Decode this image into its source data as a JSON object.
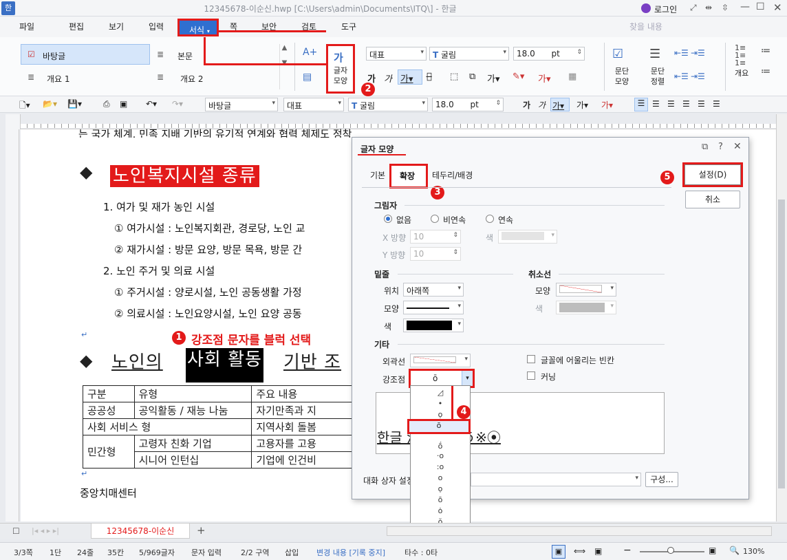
{
  "window": {
    "title": "12345678-이순신.hwp [C:\\Users\\admin\\Documents\\ITQ\\] - 한글",
    "app_icon": "한",
    "login": "로그인"
  },
  "menu": [
    "파일",
    "편집",
    "보기",
    "입력",
    "서식",
    "쪽",
    "보안",
    "검토",
    "도구"
  ],
  "ribbon": {
    "styles": [
      "바탕글",
      "본문",
      "개요 1",
      "개요 2"
    ],
    "char_shape": "글자\n모양",
    "font_lang": "대표",
    "font_name": "굴림",
    "font_size": "18.0",
    "unit": "pt",
    "para_shape": "문단\n모양",
    "para_align": "문단\n정렬",
    "outline": "개요",
    "search_placeholder": "찾을 내용"
  },
  "toolbar2": {
    "style": "바탕글",
    "lang": "대표",
    "font": "굴림",
    "size": "18.0",
    "unit": "pt"
  },
  "document": {
    "top_line": "는 국가 체계, 민족 지배 기반의 유기적 연계와 협력 체제도 정착되어야 한다.",
    "heading1": "노인복지시설 종류",
    "items": [
      "1. 여가 및 재가 농인 시설",
      "① 여가시설 : 노인복지회관, 경로당, 노인 교",
      "② 재가시설 : 방문 요양, 방문 목욕, 방문 간",
      "2. 노인 주거 및 의료 시설",
      "① 주거시설 : 양로시설, 노인 공동생활 가정",
      "② 의료시설 : 노인요양시설, 노인 요양 공동"
    ],
    "annotation1": "강조점 문자를 블럭 선택",
    "heading2_pre": "노인의 ",
    "heading2_sel": "사회 활동",
    "heading2_post": " 기반 조",
    "table": {
      "header": [
        "구분",
        "유형",
        "주요 내용"
      ],
      "rows": [
        [
          "공공성",
          "공익활동 / 재능 나눔",
          "자기만족과 지"
        ],
        [
          "사회 서비스 형",
          "",
          "지역사회 돌봄"
        ],
        [
          "민간형",
          "고령자 친화 기업",
          "고용자를 고용"
        ],
        [
          "",
          "시니어 인턴십",
          "기업에 인건비"
        ]
      ]
    },
    "footer_text": "중앙치매센터"
  },
  "dialog": {
    "title": "글자 모양",
    "tabs": [
      "기본",
      "확장",
      "테두리/배경"
    ],
    "active_tab": "확장",
    "ok": "설정(D)",
    "cancel": "취소",
    "shadow_group": "그림자",
    "shadow_opts": [
      "없음",
      "비연속",
      "연속"
    ],
    "x_dir": "X 방향",
    "y_dir": "Y 방향",
    "dir_val": "10",
    "color": "색",
    "underline_group": "밑줄",
    "underline_pos_label": "위치",
    "underline_pos": "아래쪽",
    "shape_label": "모양",
    "strike_group": "취소선",
    "other_group": "기타",
    "outline_label": "외곽선",
    "emph_label": "강조점",
    "emph_value": "ō",
    "chk_space": "글꼴에 어울리는 빈칸",
    "chk_kerning": "커닝",
    "preview": "한글 漢字あいう※⦿",
    "dialog_setting": "대화 상자 설정",
    "compose": "구성..."
  },
  "badges": [
    "1",
    "2",
    "3",
    "4",
    "5"
  ],
  "tab": {
    "doc": "12345678-이순신"
  },
  "status": [
    "3/3쪽",
    "1단",
    "24줄",
    "35칸",
    "5/969글자",
    "문자 입력",
    "2/2 구역",
    "삽입",
    "변경 내용 [기록 중지]",
    "타수 : 0타",
    "130%"
  ]
}
